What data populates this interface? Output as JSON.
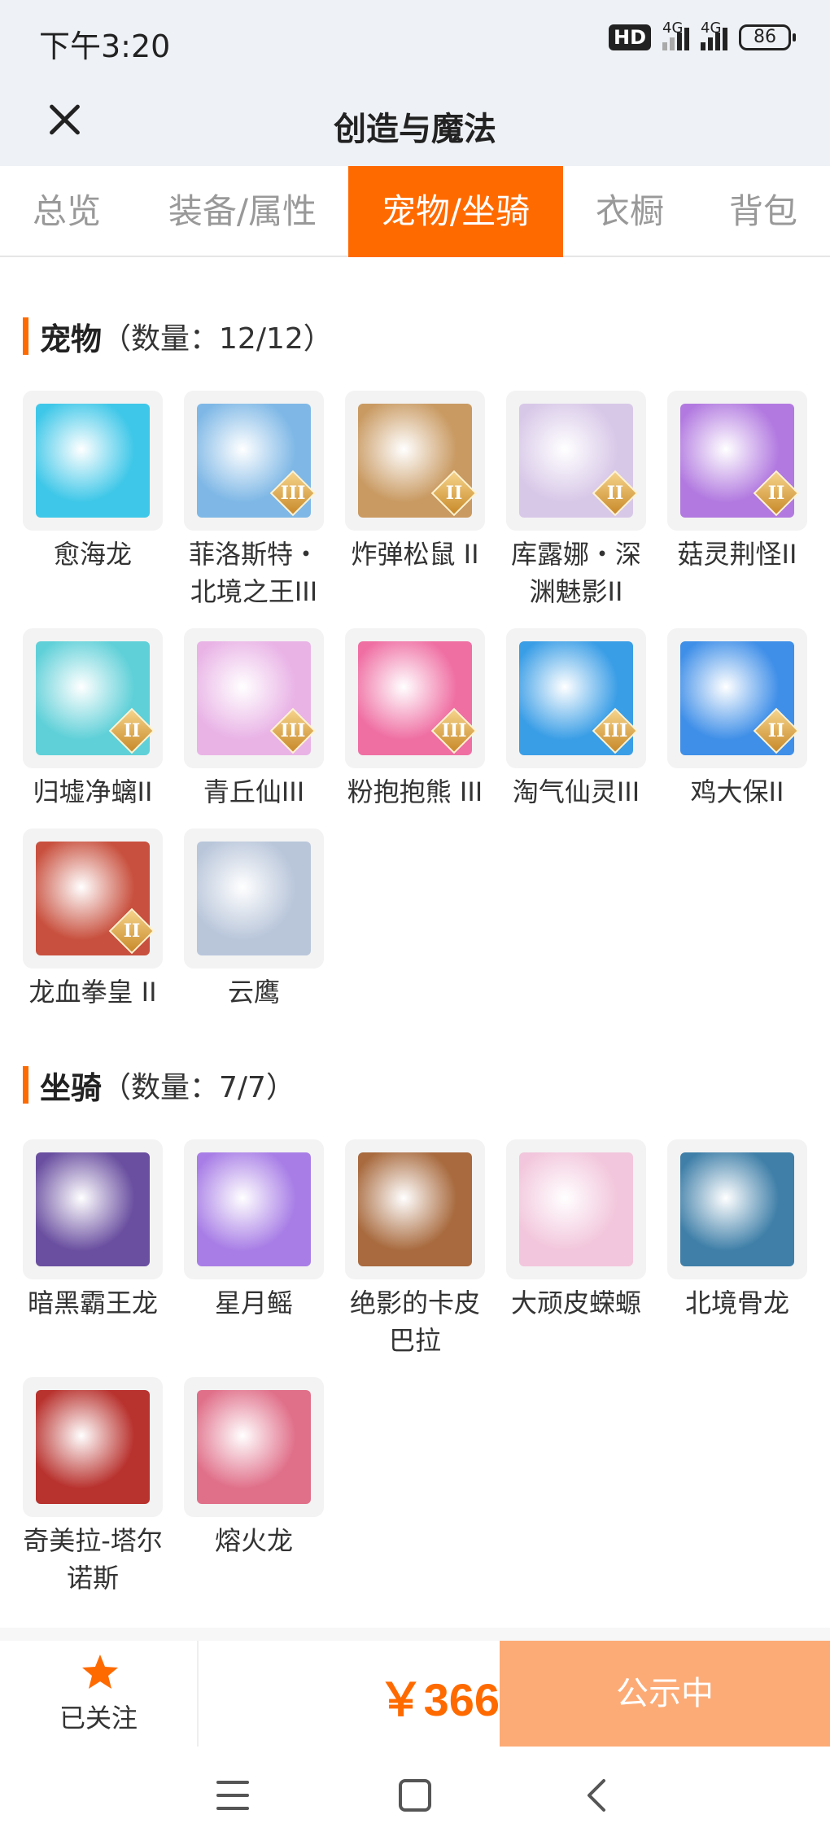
{
  "status_bar": {
    "time": "下午3:20",
    "hd_label": "HD",
    "network_1": "4G",
    "network_2": "4G",
    "battery": "86"
  },
  "header": {
    "title": "创造与魔法",
    "close_icon": "close-icon"
  },
  "tabs": [
    {
      "label": "总览",
      "active": false
    },
    {
      "label": "装备/属性",
      "active": false
    },
    {
      "label": "宠物/坐骑",
      "active": true
    },
    {
      "label": "衣橱",
      "active": false
    },
    {
      "label": "背包",
      "active": false
    }
  ],
  "pets": {
    "title": "宠物",
    "count": "（数量：12/12）",
    "items": [
      {
        "name": "愈海龙",
        "rank": "",
        "color": "#3ec7e8"
      },
      {
        "name": "菲洛斯特・北境之王III",
        "rank": "III",
        "color": "#7fb8e6"
      },
      {
        "name": "炸弹松鼠 II",
        "rank": "II",
        "color": "#c99a62"
      },
      {
        "name": "库露娜・深渊魅影II",
        "rank": "II",
        "color": "#d8c8e8"
      },
      {
        "name": "菇灵荆怪II",
        "rank": "II",
        "color": "#b27ae0"
      },
      {
        "name": "归墟净螭II",
        "rank": "II",
        "color": "#5fd0d8"
      },
      {
        "name": "青丘仙III",
        "rank": "III",
        "color": "#e9b3e6"
      },
      {
        "name": "粉抱抱熊 III",
        "rank": "III",
        "color": "#ef6fa3"
      },
      {
        "name": "淘气仙灵III",
        "rank": "III",
        "color": "#3a9ee6"
      },
      {
        "name": "鸡大保II",
        "rank": "II",
        "color": "#3f8fe8"
      },
      {
        "name": "龙血拳皇 II",
        "rank": "II",
        "color": "#c8503e"
      },
      {
        "name": "云鹰",
        "rank": "",
        "color": "#b9c6da"
      }
    ]
  },
  "mounts": {
    "title": "坐骑",
    "count": "（数量：7/7）",
    "items": [
      {
        "name": "暗黑霸王龙",
        "rank": "",
        "color": "#6a4fa0"
      },
      {
        "name": "星月鳐",
        "rank": "",
        "color": "#a87ee6"
      },
      {
        "name": "绝影的卡皮巴拉",
        "rank": "",
        "color": "#a86a3e"
      },
      {
        "name": "大顽皮蝾螈",
        "rank": "",
        "color": "#f2c6dc"
      },
      {
        "name": "北境骨龙",
        "rank": "",
        "color": "#3f7fa8"
      },
      {
        "name": "奇美拉-塔尔诺斯",
        "rank": "",
        "color": "#b8322e"
      },
      {
        "name": "熔火龙",
        "rank": "",
        "color": "#e0708a"
      }
    ]
  },
  "footer": {
    "follow_label": "已关注",
    "price": "￥366",
    "status_label": "公示中",
    "accent": "#ff6a00"
  },
  "nav_icons": [
    "menu-icon",
    "home-icon",
    "back-icon"
  ]
}
